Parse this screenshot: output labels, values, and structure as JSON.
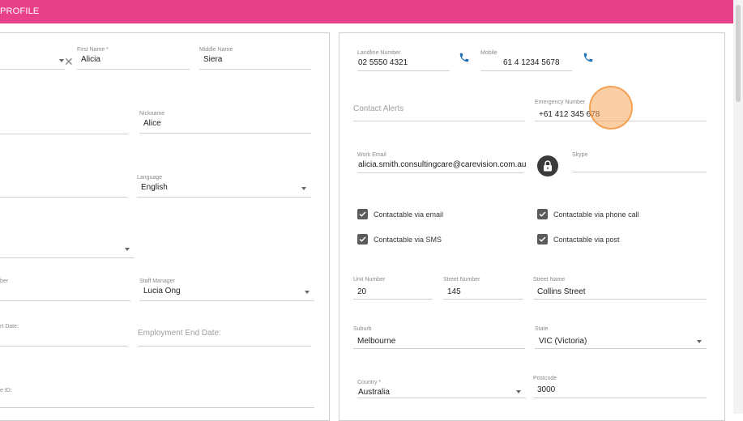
{
  "header": {
    "title": "PROFILE"
  },
  "left": {
    "first_name": {
      "label": "First Name *",
      "value": "Alicia"
    },
    "middle_name": {
      "label": "Middle Name",
      "value": "Siera"
    },
    "nickname": {
      "label": "Nickname",
      "value": "Alice"
    },
    "language": {
      "label": "Language",
      "value": "English"
    },
    "number_label": "ber",
    "staff_manager": {
      "label": "Staff Manager",
      "value": "Lucia Ong"
    },
    "start_date_label": "rt Date:",
    "employment_end_date": {
      "placeholder": "Employment End Date:"
    },
    "id_label": "e ID:"
  },
  "right": {
    "landline": {
      "label": "Landline Number",
      "value": "02 5550 4321"
    },
    "mobile": {
      "label": "Mobile",
      "value": "61 4 1234 5678"
    },
    "contact_alerts": {
      "placeholder": "Contact Alerts"
    },
    "emergency": {
      "label": "Emergency Number",
      "value": "+61 412 345 678"
    },
    "work_email": {
      "label": "Work Email",
      "value": "alicia.smith.consultingcare@carevision.com.au"
    },
    "skype": {
      "label": "Skype",
      "value": ""
    },
    "checks": [
      {
        "label": "Contactable via email",
        "checked": true
      },
      {
        "label": "Contactable via phone call",
        "checked": true
      },
      {
        "label": "Contactable via SMS",
        "checked": true
      },
      {
        "label": "Contactable via post",
        "checked": true
      }
    ],
    "unit_number": {
      "label": "Unit Number",
      "value": "20"
    },
    "street_number": {
      "label": "Street Number",
      "value": "145"
    },
    "street_name": {
      "label": "Street Name",
      "value": "Collins Street"
    },
    "suburb": {
      "label": "Suburb",
      "value": "Melbourne"
    },
    "state": {
      "label": "State",
      "value": "VIC (Victoria)"
    },
    "country": {
      "label": "Country *",
      "value": "Australia"
    },
    "postcode": {
      "label": "Postcode",
      "value": "3000"
    }
  },
  "colors": {
    "header": "#e8418a",
    "icon_blue": "#1f6fb2",
    "cursor": "#f7a85c"
  },
  "icons": {
    "phone": "phone-icon",
    "lock": "lock-icon",
    "clear": "clear-icon"
  }
}
